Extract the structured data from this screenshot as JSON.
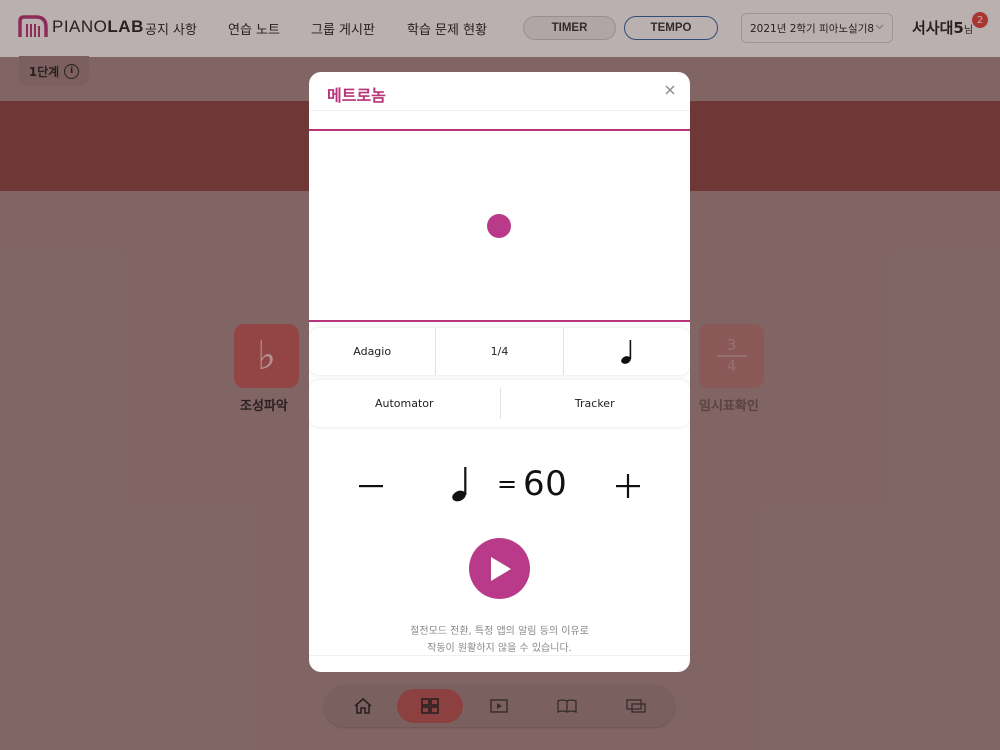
{
  "header": {
    "logo": {
      "word_light": "PIANO",
      "word_bold": "LAB"
    },
    "nav": [
      "공지 사항",
      "연습 노트",
      "그룹 게시판",
      "학습 문제 현황"
    ],
    "timer_label": "TIMER",
    "tempo_label": "TEMPO",
    "semester": "2021년 2학기 피아노실기8",
    "user_name": "서사대5",
    "user_suffix": "님",
    "badge_count": "2"
  },
  "page": {
    "level_chip": "1단계",
    "tiles": [
      {
        "label": "조성파악",
        "icon": "♭"
      },
      {
        "label": "임시표확인",
        "time_top": "3",
        "time_bottom": "4"
      }
    ],
    "dock": [
      "home-icon",
      "grid-icon",
      "play-icon",
      "book-icon",
      "screen-icon"
    ]
  },
  "modal": {
    "title": "메트로놈",
    "row1": {
      "tempo_term": "Adagio",
      "fraction": "1/4",
      "note_symbol": "♩"
    },
    "row2": {
      "automator": "Automator",
      "tracker": "Tracker"
    },
    "tempo": {
      "equals": "=",
      "bpm": "60"
    },
    "notice_line1": "절전모드 전환, 특정 앱의 알림 등의 이유로",
    "notice_line2": "작동이 원활하지 않을 수 있습니다."
  },
  "colors": {
    "accent": "#b8337a",
    "banner": "#8c4646",
    "badge": "#e2453c",
    "tempo_border": "#2f68a8"
  }
}
